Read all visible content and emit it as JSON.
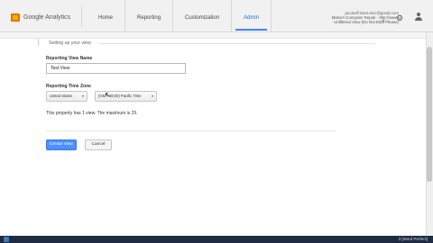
{
  "header": {
    "logo_text": "Google Analytics",
    "nav": [
      {
        "label": "Home"
      },
      {
        "label": "Reporting"
      },
      {
        "label": "Customization"
      },
      {
        "label": "Admin"
      }
    ],
    "active_tab": "Admin",
    "account": {
      "email": "jacoboff.lobsi.amz@gmail.com",
      "line2": "Matcen Computer Repair - http://www.",
      "line3": "Unfiltered View (Do Not Edit, Please)"
    },
    "icons": {
      "settings": "gear-icon",
      "user": "person-icon",
      "caret": "chevron-down-icon"
    }
  },
  "form": {
    "section_title": "Setting up your view",
    "name_label": "Reporting View Name",
    "name_value": "Test View",
    "tz_label": "Reporting Time Zone",
    "tz_country": "United States",
    "tz_zone": "(GMT-08:00) Pacific Time",
    "note": "This property has 1 view. The maximum is 25.",
    "create_button": "Create View",
    "cancel_button": "Cancel"
  },
  "taskbar": {
    "text": "3 [Word Perfect]"
  },
  "colors": {
    "accent": "#4d90fe",
    "active_tab": "#1a73e8",
    "logo": "#e37400"
  }
}
